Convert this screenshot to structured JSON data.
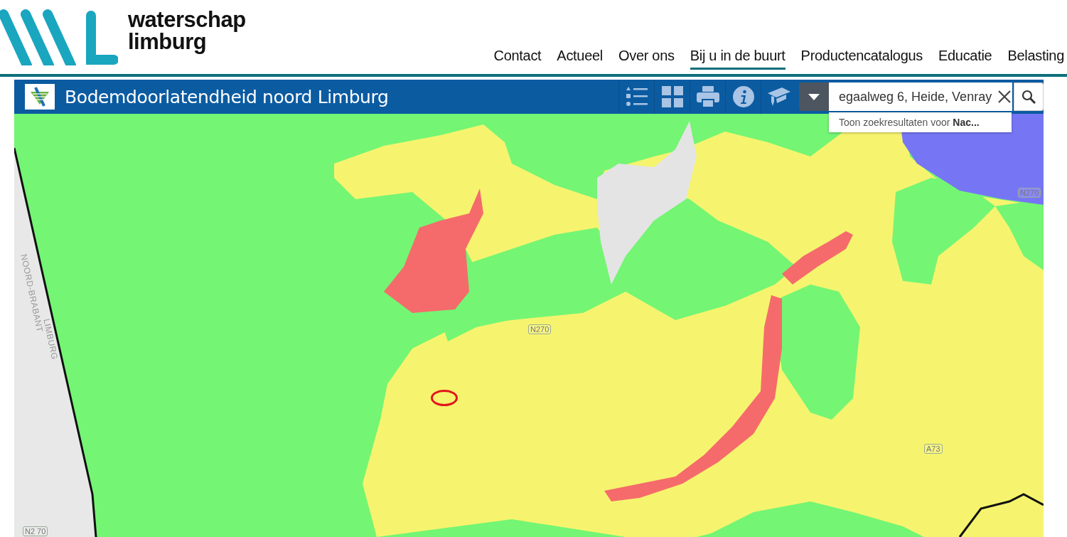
{
  "logo": {
    "lines": [
      "waterschap",
      "limburg"
    ]
  },
  "nav": [
    {
      "label": "Contact",
      "selected": false
    },
    {
      "label": "Actueel",
      "selected": false
    },
    {
      "label": "Over ons",
      "selected": false
    },
    {
      "label": "Bij u in de buurt",
      "selected": true
    },
    {
      "label": "Productencatalogus",
      "selected": false
    },
    {
      "label": "Educatie",
      "selected": false
    },
    {
      "label": "Belasting",
      "selected": false
    }
  ],
  "app": {
    "title": "Bodemdoorlatendheid noord Limburg",
    "search": {
      "value": "egaalweg 6, Heide, Venray",
      "suggestion": "Toon zoekresultaten voor **Nac...**"
    }
  },
  "map": {
    "labels": [
      {
        "text": "N270",
        "kind": "road"
      },
      {
        "text": "N270",
        "kind": "road"
      },
      {
        "text": "A73",
        "kind": "road"
      },
      {
        "text": "N2 70",
        "kind": "road"
      },
      {
        "text": "NOORD-BRABANT",
        "kind": "region"
      },
      {
        "text": "LIMBURG",
        "kind": "region"
      }
    ]
  }
}
